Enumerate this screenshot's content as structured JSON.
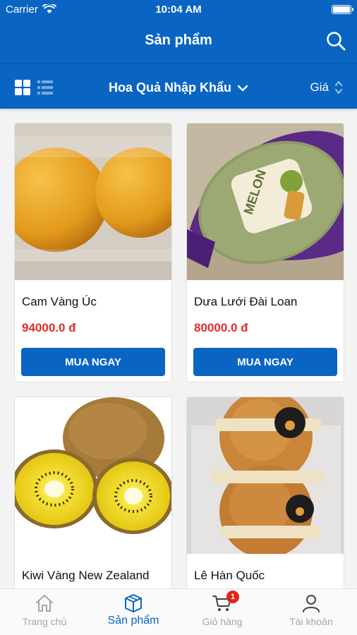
{
  "status_bar": {
    "carrier": "Carrier",
    "time": "10:04 AM"
  },
  "nav": {
    "title": "Sản phẩm",
    "search_icon": "search-icon"
  },
  "filter": {
    "view_modes": [
      "grid-icon",
      "list-icon"
    ],
    "active_view": "grid",
    "category": "Hoa Quả Nhập Khẩu",
    "sort_label": "Giá"
  },
  "products": [
    {
      "name": "Cam Vàng Úc",
      "price": "94000.0 đ",
      "buy_label": "MUA NGAY",
      "image": "oranges-image"
    },
    {
      "name": "Dưa Lưới Đài Loan",
      "price": "80000.0 đ",
      "buy_label": "MUA NGAY",
      "image": "melon-image"
    },
    {
      "name": "Kiwi Vàng New Zealand",
      "price": "",
      "buy_label": "",
      "image": "kiwi-image"
    },
    {
      "name": "Lê Hàn Quốc",
      "price": "",
      "buy_label": "",
      "image": "pears-image"
    }
  ],
  "tabs": [
    {
      "label": "Trang chủ",
      "icon": "home-icon",
      "active": false
    },
    {
      "label": "Sản phẩm",
      "icon": "box-icon",
      "active": true
    },
    {
      "label": "Giỏ hàng",
      "icon": "cart-icon",
      "active": false,
      "badge": "1"
    },
    {
      "label": "Tài khoản",
      "icon": "user-icon",
      "active": false
    }
  ],
  "colors": {
    "primary": "#0a65c2",
    "price": "#e02b2b",
    "badge": "#e0251b",
    "inactive_tab": "#a6a6a6"
  }
}
